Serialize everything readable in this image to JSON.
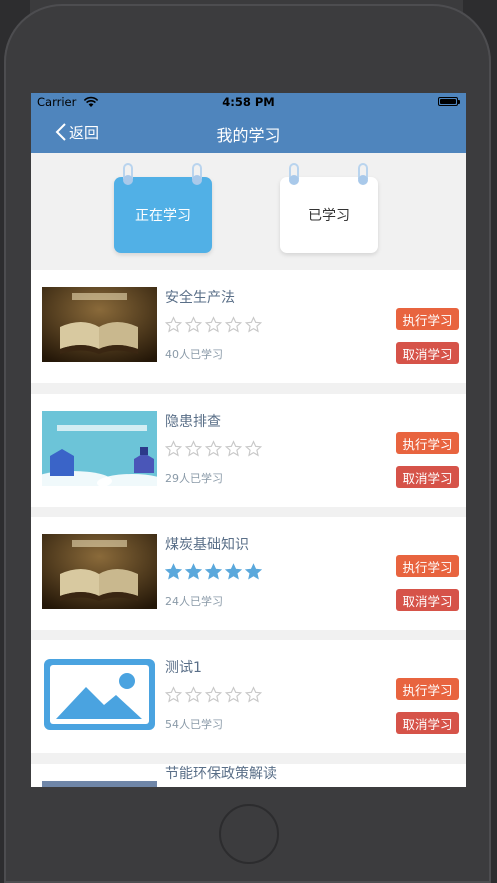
{
  "status_bar": {
    "carrier": "Carrier",
    "time": "4:58 PM"
  },
  "nav": {
    "back_label": "返回",
    "title": "我的学习"
  },
  "tabs": [
    {
      "label": "正在学习",
      "active": true
    },
    {
      "label": "已学习",
      "active": false
    }
  ],
  "courses": [
    {
      "title": "安全生产法",
      "rating": 0,
      "learners": "40人已学习",
      "thumb": "book",
      "exec_label": "执行学习",
      "cancel_label": "取消学习"
    },
    {
      "title": "隐患排查",
      "rating": 0,
      "learners": "29人已学习",
      "thumb": "campus",
      "exec_label": "执行学习",
      "cancel_label": "取消学习"
    },
    {
      "title": "煤炭基础知识",
      "rating": 5,
      "learners": "24人已学习",
      "thumb": "book",
      "exec_label": "执行学习",
      "cancel_label": "取消学习"
    },
    {
      "title": "测试1",
      "rating": 0,
      "learners": "54人已学习",
      "thumb": "placeholder",
      "exec_label": "执行学习",
      "cancel_label": "取消学习"
    },
    {
      "title": "节能环保政策解读",
      "rating": 0,
      "learners": "",
      "thumb": "dark",
      "exec_label": "",
      "cancel_label": ""
    }
  ],
  "colors": {
    "nav_bg": "#4f85bd",
    "tab_active": "#51b0e6",
    "exec_button": "#e8643f",
    "cancel_button": "#d65349",
    "star_filled": "#5aa8dc",
    "star_empty": "#c8c8c8"
  }
}
